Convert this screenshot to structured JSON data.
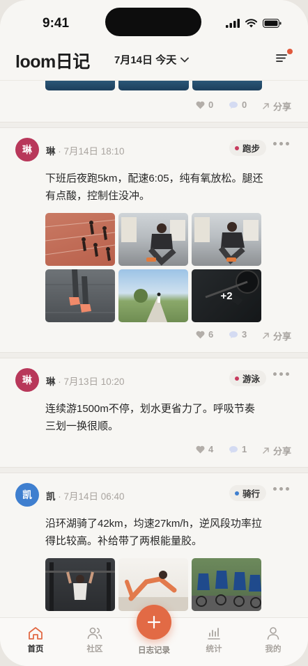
{
  "status_bar": {
    "time": "9:41"
  },
  "header": {
    "brand": "loom日记",
    "date_label": "7月14日 今天"
  },
  "posts": [
    {
      "actions": {
        "likes": "0",
        "comments": "0",
        "share": "分享"
      }
    },
    {
      "avatar": "琳",
      "avatar_color": "#b8385a",
      "author": "琳",
      "time": " · 7月14日 18:10",
      "tag": "跑步",
      "tag_color": "#c73b5e",
      "text": "下班后夜跑5km，配速6:05，纯有氧放松。腿还有点酸，控制住没冲。",
      "more_photos": "+2",
      "actions": {
        "likes": "6",
        "comments": "3",
        "share": "分享"
      }
    },
    {
      "avatar": "琳",
      "avatar_color": "#b8385a",
      "author": "琳",
      "time": " · 7月13日 10:20",
      "tag": "游泳",
      "tag_color": "#c73b5e",
      "text": "连续游1500m不停，划水更省力了。呼吸节奏三划一换很顺。",
      "actions": {
        "likes": "4",
        "comments": "1",
        "share": "分享"
      }
    },
    {
      "avatar": "凯",
      "avatar_color": "#3f7fcf",
      "author": "凯",
      "time": " · 7月14日 06:40",
      "tag": "骑行",
      "tag_color": "#3f7fcf",
      "text": "沿环湖骑了42km，均速27km/h，逆风段功率拉得比较高。补给带了两根能量胶。"
    }
  ],
  "tabbar": {
    "home": "首页",
    "community": "社区",
    "journal": "日志记录",
    "stats": "统计",
    "me": "我的"
  },
  "colors": {
    "accent": "#e26a45",
    "active_tab": "#2a2a2a"
  }
}
